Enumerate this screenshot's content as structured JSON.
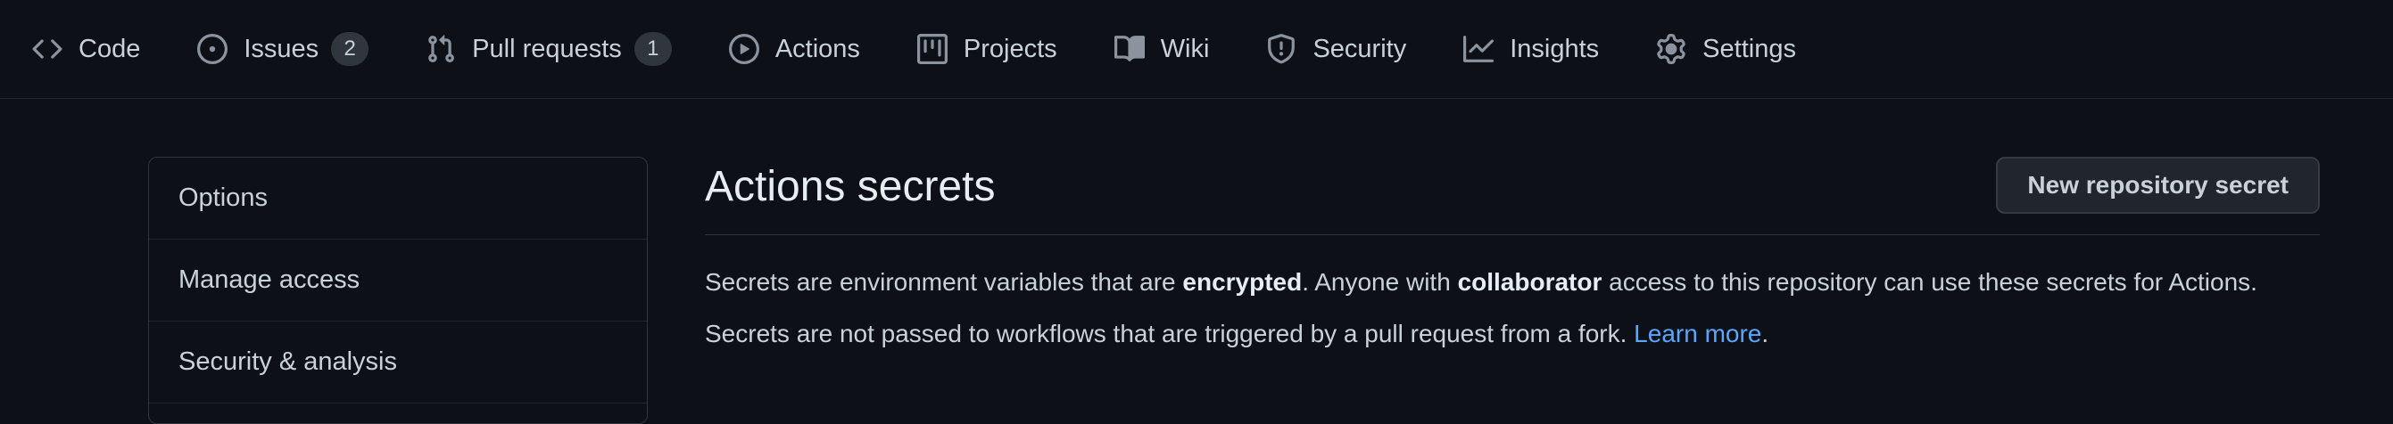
{
  "repo_nav": {
    "items": [
      {
        "label": "Code",
        "icon": "code-icon"
      },
      {
        "label": "Issues",
        "icon": "issue-opened-icon",
        "count": "2"
      },
      {
        "label": "Pull requests",
        "icon": "git-pull-request-icon",
        "count": "1"
      },
      {
        "label": "Actions",
        "icon": "play-icon"
      },
      {
        "label": "Projects",
        "icon": "project-icon"
      },
      {
        "label": "Wiki",
        "icon": "book-icon"
      },
      {
        "label": "Security",
        "icon": "shield-icon"
      },
      {
        "label": "Insights",
        "icon": "graph-icon"
      },
      {
        "label": "Settings",
        "icon": "gear-icon"
      }
    ]
  },
  "sidebar": {
    "items": [
      {
        "label": "Options"
      },
      {
        "label": "Manage access"
      },
      {
        "label": "Security & analysis"
      }
    ]
  },
  "main": {
    "title": "Actions secrets",
    "new_button_label": "New repository secret",
    "desc1": {
      "t1": "Secrets are environment variables that are ",
      "b1": "encrypted",
      "t2": ". Anyone with ",
      "b2": "collaborator",
      "t3": " access to this repository can use these secrets for Actions."
    },
    "desc2": {
      "t1": "Secrets are not passed to workflows that are triggered by a pull request from a fork. ",
      "link": "Learn more",
      "t2": "."
    }
  },
  "colors": {
    "background": "#0d1117",
    "text": "#c9d1d9",
    "muted_icon": "#8b949e",
    "link": "#58a6ff",
    "border": "#30363d",
    "button_bg": "#21262d"
  }
}
